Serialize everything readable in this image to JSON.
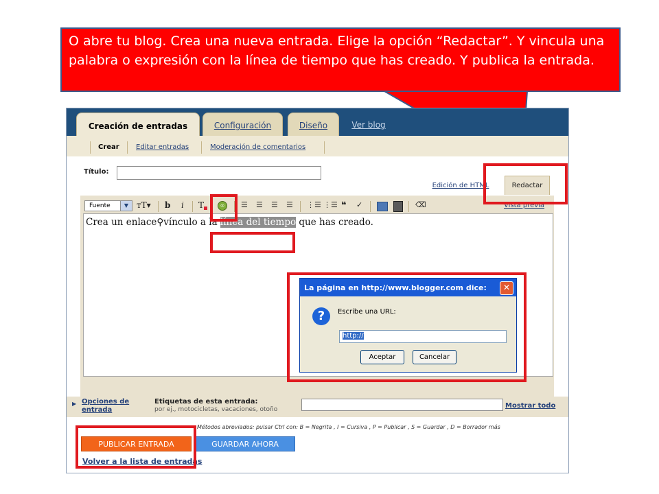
{
  "instruction": "O abre tu blog. Crea una nueva entrada. Elige la opción “Redactar”. Y vincula una palabra o expresión con la línea de tiempo que has creado. Y publica la entrada.",
  "main_tabs": [
    "Creación de entradas",
    "Configuración",
    "Diseño",
    "Ver blog"
  ],
  "sub_tabs": [
    "Crear",
    "Editar entradas",
    "Moderación de comentarios"
  ],
  "title_label": "Título:",
  "editor_modes": {
    "html": "Edición de HTML",
    "compose": "Redactar"
  },
  "toolbar": {
    "font_select": "Fuente",
    "preview_link": "Vista previa"
  },
  "editor_text": {
    "before": "Crea un enlace⚲vínculo a la ",
    "selected": "línea del tiempo",
    "after": " que has creado."
  },
  "post_options": "Opciones de entrada",
  "labels": {
    "title": "Etiquetas de esta entrada:",
    "hint": "por ej., motocicletas, vacaciones, otoño",
    "show_all": "Mostrar todo"
  },
  "shortcuts": "Métodos abreviados: pulsar Ctrl con: B = Negrita , I = Cursiva , P = Publicar , S = Guardar , D = Borrador más",
  "buttons": {
    "publish": "PUBLICAR ENTRADA",
    "save": "GUARDAR AHORA"
  },
  "back_link": "Volver a la lista de entradas",
  "dialog": {
    "title": "La página en http://www.blogger.com dice:",
    "prompt": "Escribe una URL:",
    "input_value": "http://",
    "accept": "Aceptar",
    "cancel": "Cancelar"
  },
  "colors": {
    "callout": "#ff0000",
    "highlight": "#e0191f",
    "publish": "#f2641a",
    "save": "#4a90e2",
    "dialog_title": "#1a5bd6"
  }
}
